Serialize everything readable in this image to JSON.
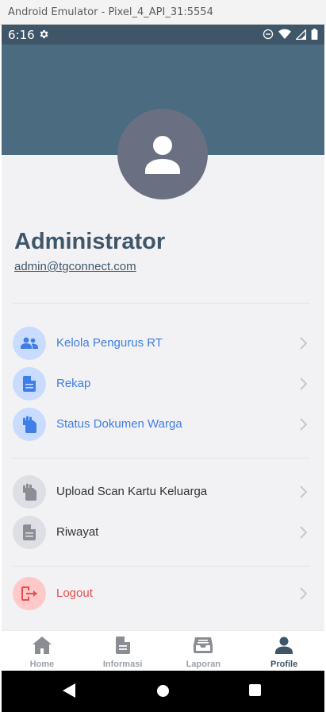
{
  "window": {
    "title": "Android Emulator - Pixel_4_API_31:5554"
  },
  "status_bar": {
    "time": "6:16"
  },
  "profile": {
    "name": "Administrator",
    "email": "admin@tgconnect.com"
  },
  "menu": {
    "admin_items": [
      {
        "label": "Kelola Pengurus RT",
        "icon": "users-icon"
      },
      {
        "label": "Rekap",
        "icon": "document-icon"
      },
      {
        "label": "Status Dokumen Warga",
        "icon": "hand-document-icon"
      }
    ],
    "user_items": [
      {
        "label": "Upload Scan Kartu Keluarga",
        "icon": "hand-document-icon"
      },
      {
        "label": "Riwayat",
        "icon": "document-icon"
      }
    ],
    "logout": {
      "label": "Logout",
      "icon": "logout-icon"
    }
  },
  "bottom_nav": [
    {
      "label": "Home",
      "icon": "home-icon",
      "active": false
    },
    {
      "label": "Informasi",
      "icon": "file-icon",
      "active": false
    },
    {
      "label": "Laporan",
      "icon": "inbox-icon",
      "active": false
    },
    {
      "label": "Profile",
      "icon": "person-icon",
      "active": true
    }
  ],
  "colors": {
    "header": "#4b6b80",
    "primary_dark": "#3f5668",
    "blue_accent": "#3e7ee5",
    "logout_red": "#ea4c4c",
    "background": "#f2f2f4"
  }
}
